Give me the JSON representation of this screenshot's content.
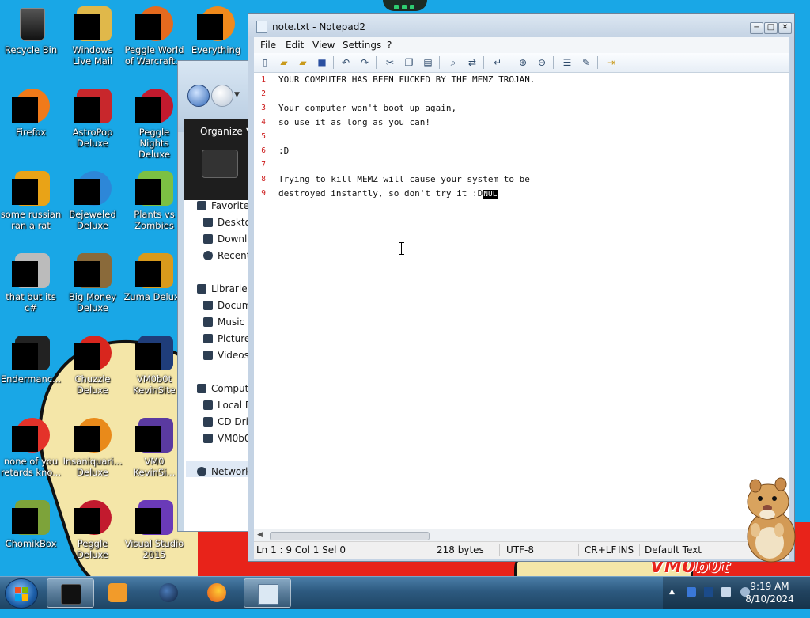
{
  "desktop": {
    "icons": [
      {
        "label": "Recycle Bin"
      },
      {
        "label": "Windows Live Mail"
      },
      {
        "label": "Peggle World of Warcraft..."
      },
      {
        "label": "Everything"
      },
      {
        "label": "Firefox"
      },
      {
        "label": "AstroPop Deluxe"
      },
      {
        "label": "Peggle Nights Deluxe"
      },
      {
        "label": "some russian ran a rat"
      },
      {
        "label": "Bejeweled Deluxe"
      },
      {
        "label": "Plants vs Zombies"
      },
      {
        "label": "that but its c#"
      },
      {
        "label": "Big Money Deluxe"
      },
      {
        "label": "Zuma Deluxe"
      },
      {
        "label": "Endermanc..."
      },
      {
        "label": "Chuzzle Deluxe"
      },
      {
        "label": "VM0b0t KevinSite"
      },
      {
        "label": "none of you retards kno..."
      },
      {
        "label": "Insaniquari... Deluxe"
      },
      {
        "label": "VM0 KevinSi..."
      },
      {
        "label": "ChomikBox"
      },
      {
        "label": "Peggle Deluxe"
      },
      {
        "label": "Visual Studio 2015"
      }
    ],
    "wallpaper_text": "VM0b0t"
  },
  "explorer": {
    "organize": "Organize",
    "nav": [
      {
        "label": "Favorites"
      },
      {
        "label": "Desktop"
      },
      {
        "label": "Downloads"
      },
      {
        "label": "Recent Places"
      },
      {
        "label": "Libraries"
      },
      {
        "label": "Documents"
      },
      {
        "label": "Music"
      },
      {
        "label": "Pictures"
      },
      {
        "label": "Videos"
      },
      {
        "label": "Computer"
      },
      {
        "label": "Local Disk"
      },
      {
        "label": "CD Drive"
      },
      {
        "label": "VM0b0t"
      },
      {
        "label": "Network"
      }
    ]
  },
  "notepad": {
    "title": "note.txt - Notepad2",
    "window_buttons": {
      "minimize": "−",
      "maximize": "□",
      "close": "✕"
    },
    "menu": {
      "file": "File",
      "edit": "Edit",
      "view": "View",
      "settings": "Settings",
      "help": "?"
    },
    "line_numbers": [
      "1",
      "2",
      "3",
      "4",
      "5",
      "6",
      "7",
      "8",
      "9"
    ],
    "lines": [
      "YOUR COMPUTER HAS BEEN FUCKED BY THE MEMZ TROJAN.",
      "",
      "Your computer won't boot up again,",
      "so use it as long as you can!",
      "",
      ":D",
      "",
      "Trying to kill MEMZ will cause your system to be",
      "destroyed instantly, so don't try it :D"
    ],
    "nul_marker": "NUL",
    "status": {
      "position": "Ln 1 : 9   Col 1   Sel 0",
      "size": "218 bytes",
      "encoding": "UTF-8",
      "eol": "CR+LF",
      "mode": "INS",
      "scheme": "Default Text"
    }
  },
  "taskbar": {
    "time": "9:19 AM",
    "date": "8/10/2024"
  },
  "colors": {
    "desktop": "#19a7e6",
    "line_number": "#cc1818",
    "taskbar": "#2d5a80"
  }
}
